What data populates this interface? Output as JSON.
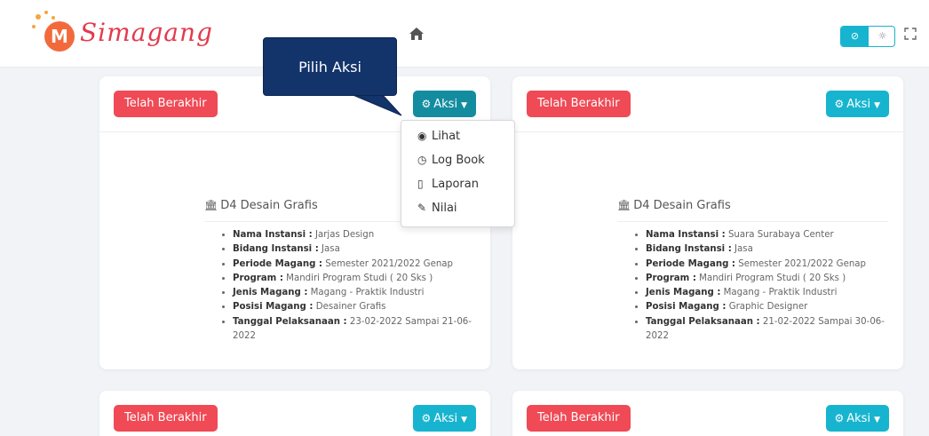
{
  "header": {
    "brand_letter": "M",
    "brand_name": "Simagang",
    "home_icon": "home-icon",
    "theme_toggle": {
      "dark_icon": "⊘",
      "light_icon": "☼"
    },
    "fullscreen_icon": "⛶"
  },
  "callout": {
    "text": "Pilih Aksi"
  },
  "dropdown": {
    "items": [
      {
        "icon": "eye-icon",
        "glyph": "◉",
        "label": "Lihat"
      },
      {
        "icon": "clock-icon",
        "glyph": "◷",
        "label": "Log Book"
      },
      {
        "icon": "file-icon",
        "glyph": "▯",
        "label": "Laporan"
      },
      {
        "icon": "edit-icon",
        "glyph": "✎",
        "label": "Nilai"
      }
    ]
  },
  "cards": [
    {
      "status": "Telah Berakhir",
      "action_label": "Aksi",
      "prodi": "D4 Desain Grafis",
      "details": [
        {
          "label": "Nama Instansi :",
          "value": " Jarjas Design"
        },
        {
          "label": "Bidang Instansi :",
          "value": " Jasa"
        },
        {
          "label": "Periode Magang :",
          "value": " Semester 2021/2022 Genap"
        },
        {
          "label": "Program :",
          "value": " Mandiri Program Studi ( 20 Sks )"
        },
        {
          "label": "Jenis Magang :",
          "value": " Magang - Praktik Industri"
        },
        {
          "label": "Posisi Magang :",
          "value": " Desainer Grafis"
        },
        {
          "label": "Tanggal Pelaksanaan :",
          "value": " 23-02-2022 Sampai 21-06-2022"
        }
      ]
    },
    {
      "status": "Telah Berakhir",
      "action_label": "Aksi",
      "prodi": "D4 Desain Grafis",
      "details": [
        {
          "label": "Nama Instansi :",
          "value": " Suara Surabaya Center"
        },
        {
          "label": "Bidang Instansi :",
          "value": " Jasa"
        },
        {
          "label": "Periode Magang :",
          "value": " Semester 2021/2022 Genap"
        },
        {
          "label": "Program :",
          "value": " Mandiri Program Studi ( 20 Sks )"
        },
        {
          "label": "Jenis Magang :",
          "value": " Magang - Praktik Industri"
        },
        {
          "label": "Posisi Magang :",
          "value": " Graphic Designer"
        },
        {
          "label": "Tanggal Pelaksanaan :",
          "value": " 21-02-2022 Sampai 30-06-2022"
        }
      ]
    },
    {
      "status": "Telah Berakhir",
      "action_label": "Aksi"
    },
    {
      "status": "Telah Berakhir",
      "action_label": "Aksi"
    }
  ],
  "colors": {
    "status_red": "#ef4a55",
    "action_teal": "#17b4cf",
    "callout_navy": "#13336b",
    "brand_red": "#e33a4d"
  }
}
